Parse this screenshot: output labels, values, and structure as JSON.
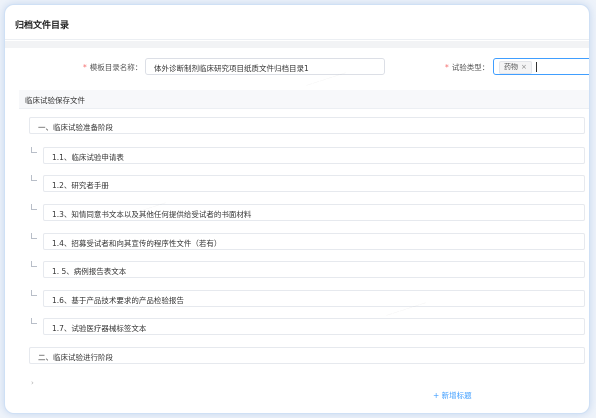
{
  "page_title": "归档文件目录",
  "form": {
    "template_label": "模板目录名称：",
    "template_value": "体外诊断制剂临床研究项目纸质文件归档目录1",
    "test_type_label": "试验类型：",
    "test_type_tag": "药物",
    "tag_close": "×"
  },
  "section": {
    "title": "临床试验保存文件"
  },
  "stages": [
    {
      "label": "一、临床试验准备阶段"
    },
    {
      "label": "二、临床试验进行阶段"
    }
  ],
  "items": [
    {
      "label": "1.1、临床试验申请表"
    },
    {
      "label": "1.2、研究者手册"
    },
    {
      "label": "1.3、知情同意书文本以及其他任何提供给受试者的书面材料"
    },
    {
      "label": "1.4、招募受试者和向其宣传的程序性文件（若有）"
    },
    {
      "label": "1. 5、病例报告表文本"
    },
    {
      "label": "1.6、基于产品技术要求的产品检验报告"
    },
    {
      "label": "1.7、试验医疗器械标签文本"
    }
  ],
  "collapse_mark": "›",
  "add_link": "+ 新增标题"
}
